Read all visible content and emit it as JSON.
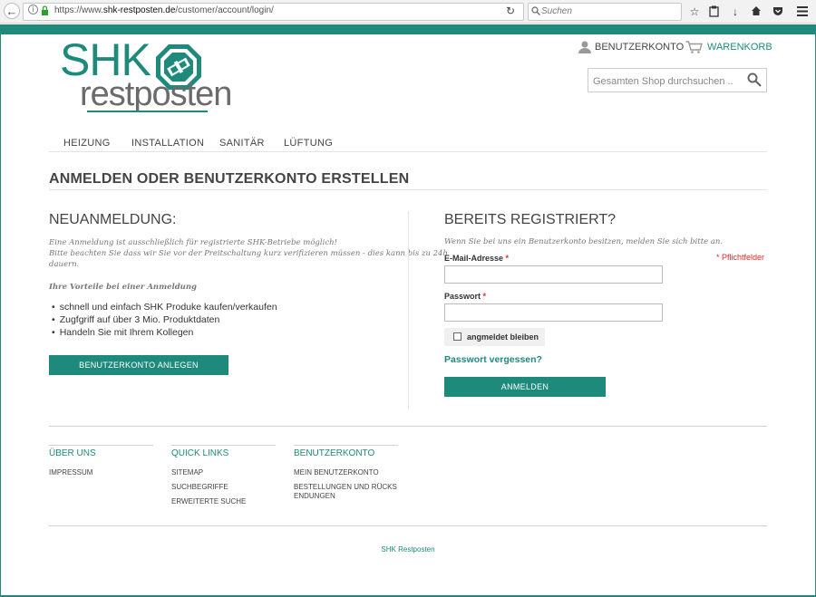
{
  "browser": {
    "url_prefix": "https://www.",
    "url_domain": "shk-restposten.de",
    "url_path": "/customer/account/login/",
    "search_placeholder": "Suchen"
  },
  "header": {
    "logo_top": "SHK",
    "logo_bottom": "restposten",
    "account_label": "BENUTZERKONTO",
    "cart_label": "WARENKORB",
    "search_placeholder": "Gesamten Shop durchsuchen .."
  },
  "nav": {
    "items": [
      "HEIZUNG",
      "INSTALLATION",
      "SANITÄR",
      "LÜFTUNG"
    ]
  },
  "page_title": "ANMELDEN ODER BENUTZERKONTO ERSTELLEN",
  "new_customer": {
    "heading": "NEUANMELDUNG:",
    "intro_lines": [
      "Eine Anmeldung ist ausschließlich für registrierte SHK-Betriebe möglich!",
      "Bitte beachten Sie dass wir Sie vor der Preitschaltung kurz verifizieren müssen - dies kann bis zu 24h",
      "dauern."
    ],
    "benefits_title": "Ihre Vorteile bei einer Anmeldung",
    "benefits": [
      "schnell und einfach SHK Produke kaufen/verkaufen",
      "Zugfgriff auf über 3 Mio. Produktdaten",
      "Handeln Sie mit Ihrem Kollegen"
    ],
    "create_button": "BENUTZERKONTO ANLEGEN"
  },
  "registered": {
    "heading": "BEREITS REGISTRIERT?",
    "intro": "Wenn Sie bei uns ein Benutzerkonto besitzen, melden Sie sich bitte an.",
    "required_note": "* Pflichtfelder",
    "email_label": "E-Mail-Adresse",
    "email_value": "",
    "password_label": "Passwort",
    "password_value": "",
    "required_star": "*",
    "remember_label": "angmeldet bleiben",
    "remember_checked": false,
    "forgot_link": "Passwort vergessen?",
    "login_button": "ANMELDEN"
  },
  "footer": {
    "columns": [
      {
        "heading": "ÜBER UNS",
        "links": [
          "IMPRESSUM"
        ]
      },
      {
        "heading": "QUICK LINKS",
        "links": [
          "SITEMAP",
          "SUCHBEGRIFFE",
          "ERWEITERTE SUCHE"
        ]
      },
      {
        "heading": "BENUTZERKONTO",
        "links": [
          "MEIN BENUTZERKONTO",
          "BESTELLUNGEN UND RÜCKS",
          "ENDUNGEN"
        ]
      }
    ],
    "copyright": "SHK Restposten"
  },
  "colors": {
    "brand": "#1e8a7c",
    "required": "#e02b27"
  },
  "icons": [
    "back-arrow-icon",
    "info-icon",
    "lock-icon",
    "reload-icon",
    "search-icon",
    "star-icon",
    "clipboard-icon",
    "download-icon",
    "home-icon",
    "pocket-icon",
    "menu-icon",
    "user-icon",
    "cart-icon"
  ]
}
